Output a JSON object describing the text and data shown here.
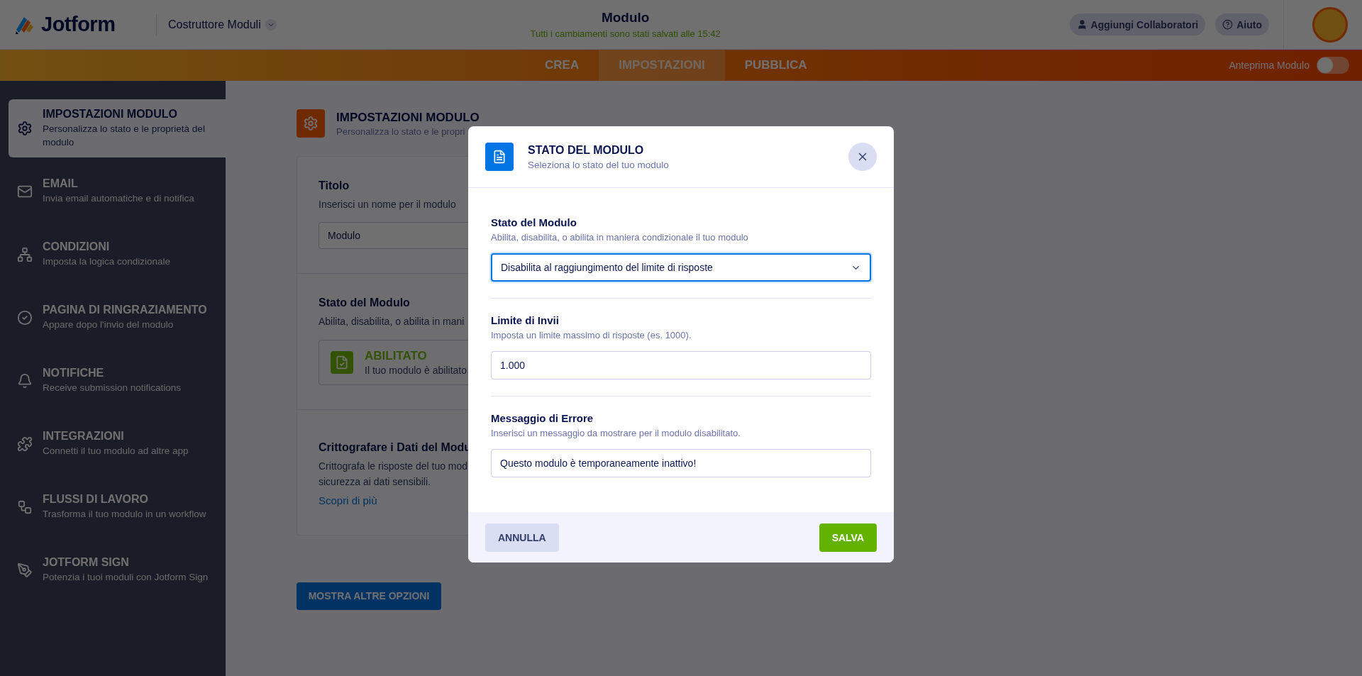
{
  "header": {
    "logo": "Jotform",
    "builder_menu": "Costruttore Moduli",
    "title": "Modulo",
    "save_status": "Tutti i cambiamenti sono stati salvati alle 15:42",
    "buttons": [
      "Aggiungi Collaboratori",
      "Aiuto"
    ]
  },
  "nav": {
    "tabs": [
      {
        "label": "CREA",
        "selected": false
      },
      {
        "label": "IMPOSTAZIONI",
        "selected": true
      },
      {
        "label": "PUBBLICA",
        "selected": false
      }
    ],
    "preview": {
      "label": "Anteprima Modulo",
      "on": false
    }
  },
  "sidebar": {
    "items": [
      {
        "title": "IMPOSTAZIONI MODULO",
        "description": "Personalizza lo stato e le proprietà del modulo",
        "selected": true
      },
      {
        "title": "EMAIL",
        "description": "Invia email automatiche e di notifica",
        "selected": false
      },
      {
        "title": "CONDIZIONI",
        "description": "Imposta la logica condizionale",
        "selected": false
      },
      {
        "title": "PAGINA DI RINGRAZIAMENTO",
        "description": "Appare dopo l'invio del modulo",
        "selected": false
      },
      {
        "title": "NOTIFICHE",
        "description": "Receive submission notifications",
        "selected": false
      },
      {
        "title": "INTEGRAZIONI",
        "description": "Connetti il tuo modulo ad altre app",
        "selected": false
      },
      {
        "title": "FLUSSI DI LAVORO",
        "description": "Trasforma il tuo modulo in un workflow",
        "selected": false
      },
      {
        "title": "JOTFORM SIGN",
        "description": "Potenzia i tuoi moduli con Jotform Sign",
        "selected": false
      }
    ]
  },
  "settings": {
    "title": "IMPOSTAZIONI MODULO",
    "subtitle": "Personalizza lo stato e le propri",
    "title_field": {
      "label": "Titolo",
      "hint": "Inserisci un nome per il modulo",
      "value": "Modulo"
    },
    "status": {
      "label": "Stato del Modulo",
      "hint": "Abilita, disabilita, o abilita in mani",
      "state": "ABILITATO",
      "state_text": "Il tuo modulo è abilitato"
    },
    "encryption": {
      "label": "Crittografare i Dati del Modu",
      "lines": [
        "Crittografa le risposte del tuo mod",
        "sicurezza ai dati sensibili."
      ],
      "link": "Scopri di più"
    },
    "more_button": "MOSTRA ALTRE OPZIONI"
  },
  "modal": {
    "title": "STATO DEL MODULO",
    "subtitle": "Seleziona lo stato del tuo modulo",
    "sections": [
      {
        "kind": "select",
        "label": "Stato del Modulo",
        "hint": "Abilita, disabilita, o abilita in maniera condizionale il tuo modulo",
        "value": "Disabilita al raggiungimento del limite di risposte"
      },
      {
        "kind": "input",
        "label": "Limite di Invii",
        "hint": "Imposta un limite massimo di risposte (es. 1000).",
        "value": "1.000"
      },
      {
        "kind": "input",
        "label": "Messaggio di Errore",
        "hint": "Inserisci un messaggio da mostrare per il modulo disabilitato.",
        "value": "Questo modulo è temporaneamente inattivo!"
      }
    ],
    "cancel": "ANNULLA",
    "save": "SALVA"
  }
}
